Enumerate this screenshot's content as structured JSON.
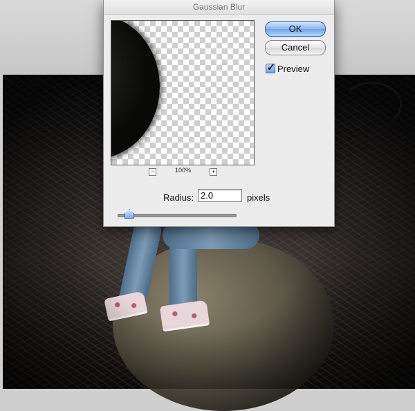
{
  "dialog": {
    "title": "Gaussian Blur",
    "ok_label": "OK",
    "cancel_label": "Cancel",
    "preview_label": "Preview",
    "preview_checked": true,
    "zoom_out_label": "−",
    "zoom_in_label": "+",
    "zoom_level": "100%",
    "radius_label": "Radius:",
    "radius_value": "2.0",
    "radius_units": "pixels",
    "radius_slider_fraction": 0.06
  },
  "colors": {
    "default_button": "#6ea3e6",
    "dialog_bg": "#ececec"
  },
  "icons": [
    "zoom-out-icon",
    "zoom-in-icon",
    "checkmark-icon",
    "slider-thumb-icon"
  ]
}
